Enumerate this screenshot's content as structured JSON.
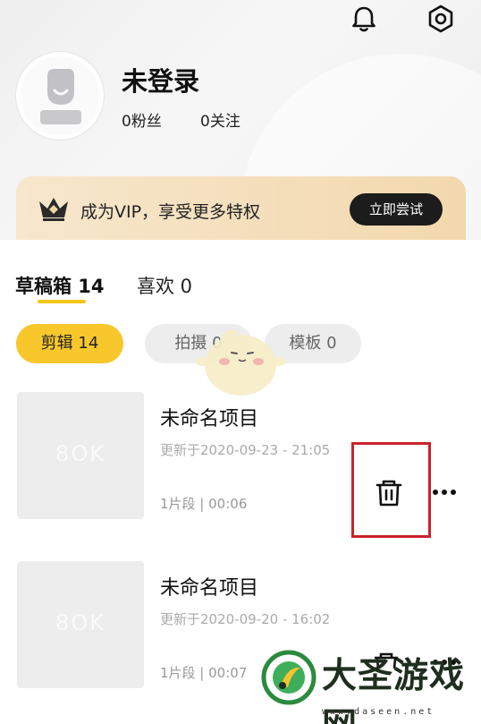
{
  "profile": {
    "username": "未登录",
    "fans": "0粉丝",
    "following": "0关注"
  },
  "vip": {
    "text": "成为VIP，享受更多特权",
    "button": "立即尝试"
  },
  "tabs": [
    {
      "label": "草稿箱 14",
      "active": true
    },
    {
      "label": "喜欢 0",
      "active": false
    }
  ],
  "filters": [
    {
      "label": "剪辑 14",
      "active": true
    },
    {
      "label": "拍摄 0",
      "active": false
    },
    {
      "label": "模板 0",
      "active": false
    }
  ],
  "projects": [
    {
      "title": "未命名项目",
      "updated": "更新于2020-09-23 - 21:05",
      "meta": "1片段 | 00:06",
      "thumb_logo": "8OK"
    },
    {
      "title": "未命名项目",
      "updated": "更新于2020-09-20 - 16:02",
      "meta": "1片段 | 00:07",
      "thumb_logo": "8OK"
    }
  ],
  "watermark": {
    "title": "大圣游戏网",
    "url": "www.daseen.net"
  },
  "icons": {
    "notification": "bell-icon",
    "settings": "gear-icon",
    "vip": "crown-icon",
    "delete": "trash-icon",
    "more": "more-icon"
  },
  "colors": {
    "accent": "#f7c72c",
    "highlight_box": "#c9232a",
    "vip_button": "#1c1c1c"
  }
}
